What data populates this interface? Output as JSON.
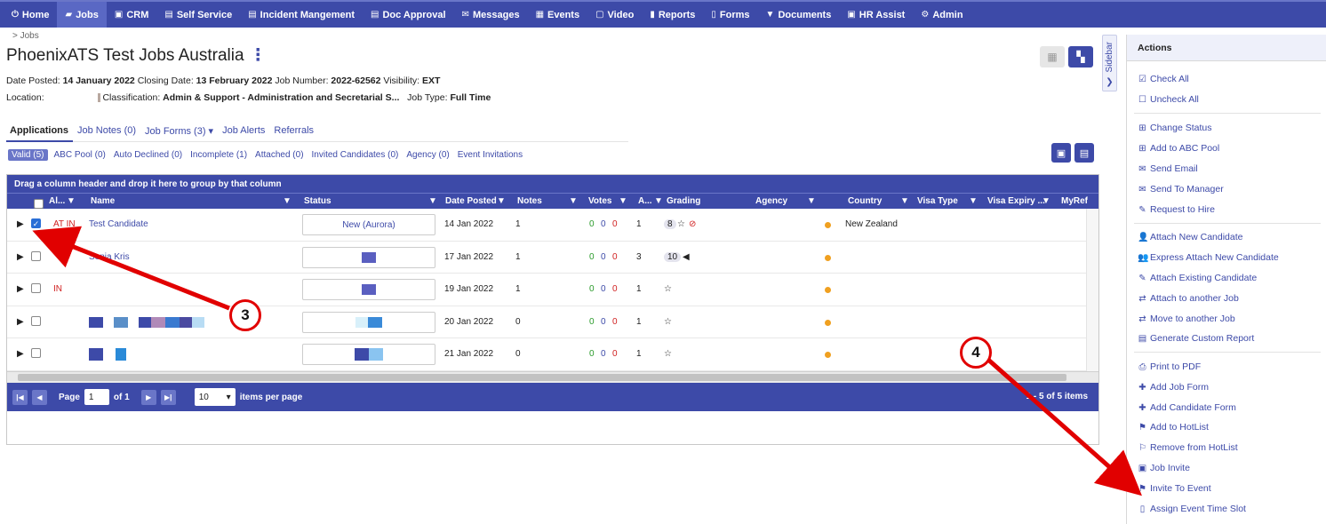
{
  "nav": [
    {
      "label": "Home",
      "icon": "power-icon"
    },
    {
      "label": "Jobs",
      "icon": "folder-icon",
      "active": true
    },
    {
      "label": "CRM",
      "icon": "briefcase-icon"
    },
    {
      "label": "Self Service",
      "icon": "card-icon"
    },
    {
      "label": "Incident Mangement",
      "icon": "card-icon"
    },
    {
      "label": "Doc Approval",
      "icon": "card-icon"
    },
    {
      "label": "Messages",
      "icon": "envelope-icon"
    },
    {
      "label": "Events",
      "icon": "calendar-icon"
    },
    {
      "label": "Video",
      "icon": "video-icon"
    },
    {
      "label": "Reports",
      "icon": "book-icon"
    },
    {
      "label": "Forms",
      "icon": "file-icon"
    },
    {
      "label": "Documents",
      "icon": "filter-icon"
    },
    {
      "label": "HR Assist",
      "icon": "briefcase-icon"
    },
    {
      "label": "Admin",
      "icon": "gear-icon"
    }
  ],
  "breadcrumb": "> Jobs",
  "title": "PhoenixATS Test Jobs Australia",
  "meta": {
    "date_posted_label": "Date Posted:",
    "date_posted": "14 January 2022",
    "closing_label": "Closing Date:",
    "closing": "13 February 2022",
    "job_number_label": "Job Number:",
    "job_number": "2022-62562",
    "visibility_label": "Visibility:",
    "visibility": "EXT",
    "location_label": "Location:",
    "classification_label": "Classification:",
    "classification": "Admin & Support - Administration and Secretarial S...",
    "job_type_label": "Job Type:",
    "job_type": "Full Time"
  },
  "tabs": [
    "Applications",
    "Job Notes (0)",
    "Job Forms (3) ▾",
    "Job Alerts",
    "Referrals"
  ],
  "subtabs": [
    "Valid (5)",
    "ABC Pool (0)",
    "Auto Declined (0)",
    "Incomplete (1)",
    "Attached (0)",
    "Invited Candidates (0)",
    "Agency (0)",
    "Event Invitations"
  ],
  "grid": {
    "group_hint": "Drag a column header and drop it here to group by that column",
    "columns": [
      "Al...",
      "Name",
      "Status",
      "Date Posted",
      "Notes",
      "Votes",
      "A...",
      "Grading",
      "Agency",
      "Country",
      "Visa Type",
      "Visa Expiry ...",
      "MyRef"
    ],
    "rows": [
      {
        "alert": "AT IN",
        "name": "Test Candidate",
        "status": "New (Aurora)",
        "date": "14 Jan 2022",
        "notes": "1",
        "votes": [
          "0",
          "0",
          "0"
        ],
        "a": "1",
        "grading": "8",
        "country": "New Zealand",
        "checked": true
      },
      {
        "alert": "",
        "name": "Sonia Kris",
        "status": "",
        "date": "17 Jan 2022",
        "notes": "1",
        "votes": [
          "0",
          "0",
          "0"
        ],
        "a": "3",
        "grading": "10",
        "country": "",
        "checked": false
      },
      {
        "alert": "IN",
        "name": "",
        "status": "",
        "date": "19 Jan 2022",
        "notes": "1",
        "votes": [
          "0",
          "0",
          "0"
        ],
        "a": "1",
        "grading": "",
        "country": "",
        "checked": false
      },
      {
        "alert": "",
        "name": "",
        "status": "",
        "date": "20 Jan 2022",
        "notes": "0",
        "votes": [
          "0",
          "0",
          "0"
        ],
        "a": "1",
        "grading": "",
        "country": "",
        "checked": false
      },
      {
        "alert": "",
        "name": "",
        "status": "",
        "date": "21 Jan 2022",
        "notes": "0",
        "votes": [
          "0",
          "0",
          "0"
        ],
        "a": "1",
        "grading": "",
        "country": "",
        "checked": false
      }
    ]
  },
  "pager": {
    "page_label": "Page",
    "page": "1",
    "of_label": "of 1",
    "page_size": "10",
    "per_page_label": "items per page",
    "info": "1 - 5 of 5 items"
  },
  "sidebar_toggle": "Sidebar",
  "actions": {
    "title": "Actions",
    "items": [
      "Check All",
      "Uncheck All",
      "Change Status",
      "Add to ABC Pool",
      "Send Email",
      "Send To Manager",
      "Request to Hire",
      "Attach New Candidate",
      "Express Attach New Candidate",
      "Attach Existing Candidate",
      "Attach to another Job",
      "Move to another Job",
      "Generate Custom Report",
      "Print to PDF",
      "Add Job Form",
      "Add Candidate Form",
      "Add to HotList",
      "Remove from HotList",
      "Job Invite",
      "Invite To Event",
      "Assign Event Time Slot"
    ]
  },
  "annotations": [
    "3",
    "4"
  ],
  "colors": {
    "primary": "#3d4aa8",
    "annotation": "#e10000",
    "dot": "#f0a020"
  }
}
